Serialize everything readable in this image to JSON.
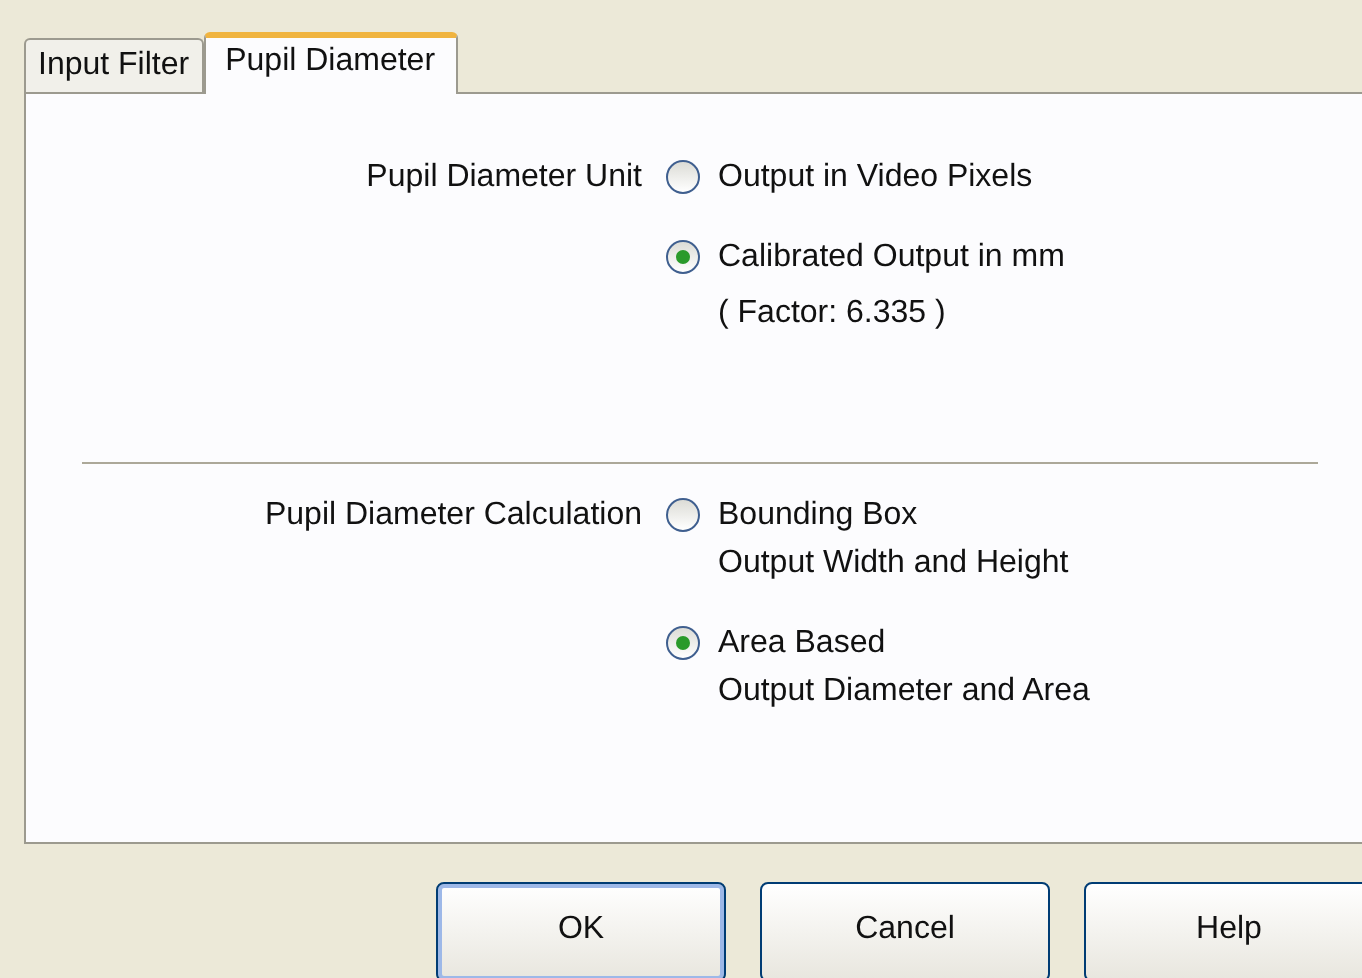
{
  "tabs": [
    {
      "label": "Input Filter",
      "selected": false
    },
    {
      "label": "Pupil Diameter",
      "selected": true
    }
  ],
  "sections": [
    {
      "label": "Pupil Diameter Unit",
      "options": [
        {
          "lines": [
            "Output in Video Pixels"
          ],
          "selected": false
        },
        {
          "lines": [
            "Calibrated Output in mm"
          ],
          "selected": true
        }
      ],
      "note": "( Factor: 6.335 )"
    },
    {
      "label": "Pupil Diameter Calculation",
      "options": [
        {
          "lines": [
            "Bounding Box",
            "Output Width and Height"
          ],
          "selected": false
        },
        {
          "lines": [
            "Area Based",
            "Output Diameter and Area"
          ],
          "selected": true
        }
      ]
    }
  ],
  "buttons": [
    {
      "label": "OK",
      "default": true
    },
    {
      "label": "Cancel",
      "default": false
    },
    {
      "label": "Help",
      "default": false
    }
  ]
}
